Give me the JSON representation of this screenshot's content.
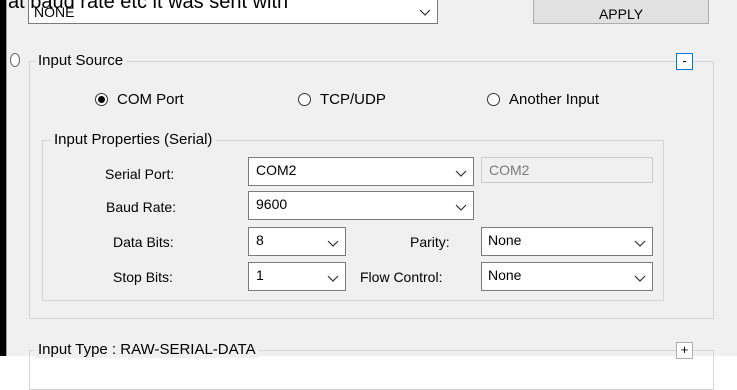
{
  "caption_text": "at baud rate etc it was sent with",
  "top_combo": {
    "value": "NONE"
  },
  "apply_button": {
    "label": "APPLY"
  },
  "input_source": {
    "title": "Input Source",
    "collapse_symbol": "-",
    "radios": [
      {
        "label": "COM Port",
        "checked": true
      },
      {
        "label": "TCP/UDP",
        "checked": false
      },
      {
        "label": "Another Input",
        "checked": false
      }
    ]
  },
  "serial_props": {
    "title": "Input Properties (Serial)",
    "serial_port_label": "Serial Port:",
    "serial_port_value": "COM2",
    "serial_port_readonly": "COM2",
    "baud_rate_label": "Baud Rate:",
    "baud_rate_value": "9600",
    "data_bits_label": "Data Bits:",
    "data_bits_value": "8",
    "parity_label": "Parity:",
    "parity_value": "None",
    "stop_bits_label": "Stop Bits:",
    "stop_bits_value": "1",
    "flow_control_label": "Flow Control:",
    "flow_control_value": "None"
  },
  "input_type": {
    "title": "Input Type : RAW-SERIAL-DATA",
    "expand_symbol": "+"
  }
}
